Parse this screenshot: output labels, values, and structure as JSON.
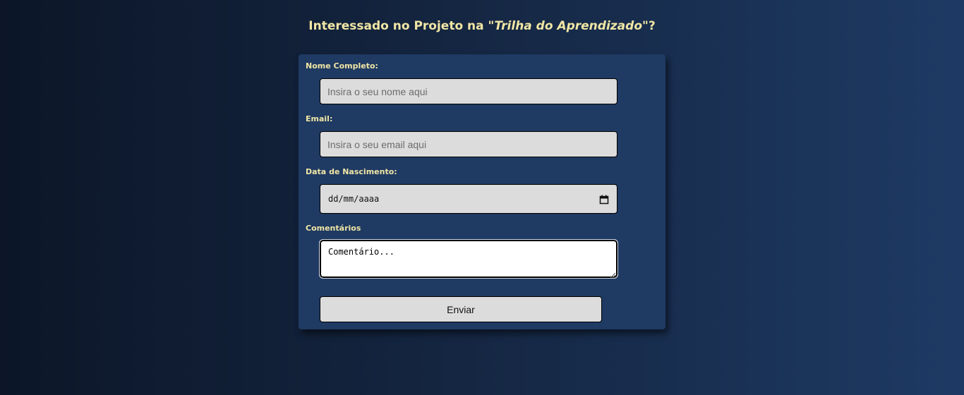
{
  "header": {
    "title_prefix": "Interessado no Projeto na \"",
    "title_emphasis": "Trilha do Aprendizado",
    "title_suffix": "\"?"
  },
  "form": {
    "name_label": "Nome Completo:",
    "name_placeholder": "Insira o seu nome aqui",
    "email_label": "Email:",
    "email_placeholder": "Insira o seu email aqui",
    "birthdate_label": "Data de Nascimento:",
    "birthdate_value": "dd/mm/aaaa",
    "comments_label": "Comentários",
    "comments_placeholder": "Comentário...",
    "submit_label": "Enviar"
  },
  "icons": {
    "date_picker": "calendar-icon",
    "textarea_grip": "resize-grip-icon"
  },
  "colors": {
    "label_text": "#f0e6a4",
    "card_background": "#1f3a63",
    "input_background": "#dcdcdc"
  }
}
